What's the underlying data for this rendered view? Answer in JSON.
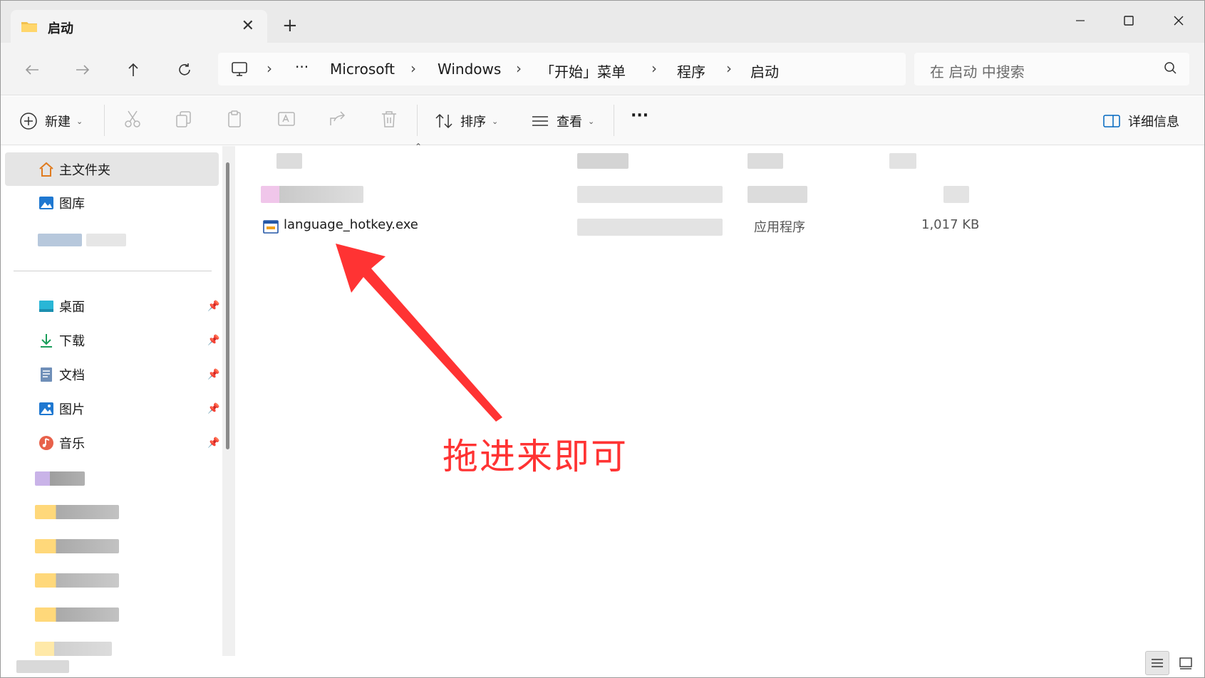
{
  "tab": {
    "title": "启动",
    "close_glyph": "✕",
    "new_tab_glyph": "+"
  },
  "window_controls": {
    "minimize": "—",
    "maximize": "☐",
    "close": "✕"
  },
  "breadcrumb": {
    "more": "···",
    "items": [
      "Microsoft",
      "Windows",
      "「开始」菜单",
      "程序",
      "启动"
    ],
    "separator": "›"
  },
  "search": {
    "placeholder": "在 启动 中搜索"
  },
  "toolbar": {
    "new_label": "新建",
    "sort_label": "排序",
    "view_label": "查看",
    "more": "···",
    "details_label": "详细信息"
  },
  "sidebar": {
    "items": [
      {
        "label": "主文件夹",
        "icon": "home-icon",
        "selected": true
      },
      {
        "label": "图库",
        "icon": "gallery-icon"
      }
    ],
    "quick_access": [
      {
        "label": "桌面",
        "icon": "desktop-icon",
        "pin": "📌"
      },
      {
        "label": "下载",
        "icon": "download-icon",
        "pin": "📌"
      },
      {
        "label": "文档",
        "icon": "document-icon",
        "pin": "📌"
      },
      {
        "label": "图片",
        "icon": "picture-icon",
        "pin": "📌"
      },
      {
        "label": "音乐",
        "icon": "music-icon",
        "pin": "📌"
      }
    ]
  },
  "file": {
    "name": "language_hotkey.exe",
    "type": "应用程序",
    "size": "1,017 KB",
    "icon": "exe-icon"
  },
  "annotation": {
    "text": "拖进来即可",
    "color": "#ff3333"
  },
  "colors": {
    "accent": "#0067c0",
    "arrow": "#ff3333"
  }
}
